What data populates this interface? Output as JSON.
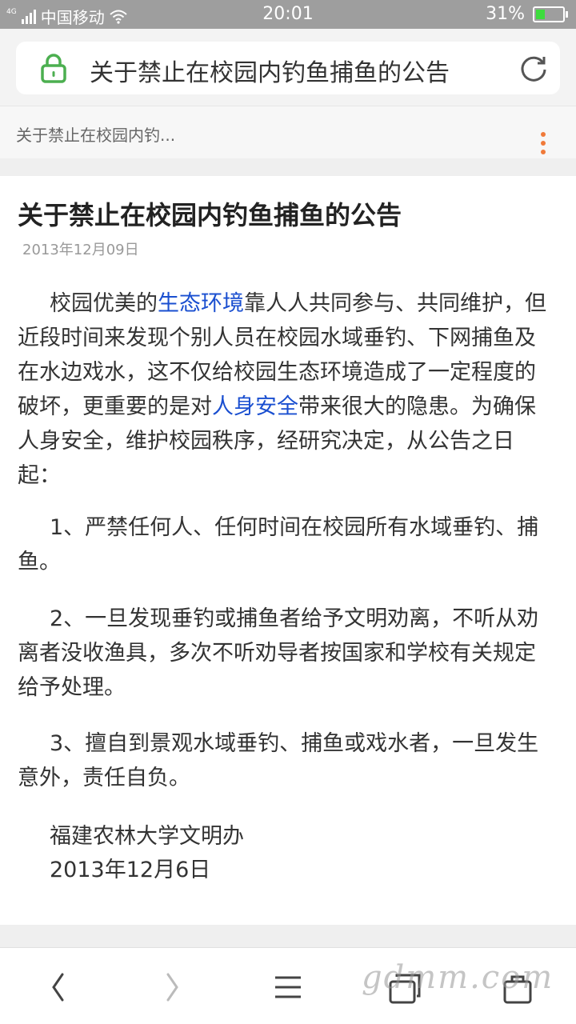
{
  "status_bar": {
    "network_label": "4G",
    "carrier": "中国移动",
    "time": "20:01",
    "battery_percent_label": "31%",
    "battery_level": 0.31,
    "battery_color": "#3ddc3d"
  },
  "url_bar": {
    "title": "关于禁止在校园内钓鱼捕鱼的公告",
    "lock_color": "#4caf50"
  },
  "tab": {
    "title": "关于禁止在校园内钓..."
  },
  "article": {
    "headline": "关于禁止在校园内钓鱼捕鱼的公告",
    "date": "2013年12月09日",
    "p1_a": "校园优美的",
    "p1_link1": "生态环境",
    "p1_b": "靠人人共同参与、共同维护，但近段时间来发现个别人员在校园水域垂钓、下网捕鱼及在水边戏水，这不仅给校园生态环境造成了一定程度的破坏，更重要的是对",
    "p1_link2": "人身安全",
    "p1_c": "带来很大的隐患。为确保人身安全，维护校园秩序，经研究决定，从公告之日起：",
    "item1": "1、严禁任何人、任何时间在校园所有水域垂钓、捕鱼。",
    "item2": "2、一旦发现垂钓或捕鱼者给予文明劝离，不听从劝离者没收渔具，多次不听劝导者按国家和学校有关规定给予处理。",
    "item3": "3、擅自到景观水域垂钓、捕鱼或戏水者，一旦发生意外，责任自负。",
    "signature_org": "福建农林大学文明办",
    "signature_date": "2013年12月6日",
    "link_color": "#1a4fd0"
  },
  "watermark": "gdmm.com",
  "icons": {
    "signal": "signal-icon",
    "wifi": "wifi-icon",
    "battery": "battery-icon",
    "lock": "lock-icon",
    "refresh": "refresh-icon",
    "menu": "more-vertical-icon",
    "back": "chevron-left-icon",
    "forward": "chevron-right-icon",
    "menu_nav": "hamburger-icon",
    "tabs": "tabs-icon",
    "home": "home-icon"
  }
}
